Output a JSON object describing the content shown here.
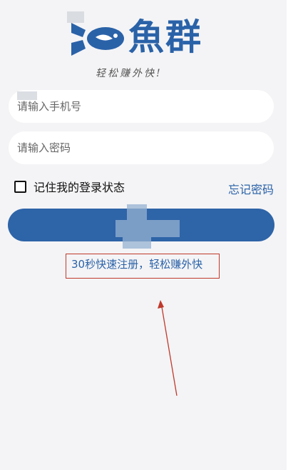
{
  "app": {
    "name": "魚群",
    "slogan": "轻松赚外快!"
  },
  "login": {
    "phone_placeholder": "请输入手机号",
    "password_placeholder": "请输入密码",
    "remember_label": "记住我的登录状态",
    "remember_checked": false,
    "forgot_label": "忘记密码",
    "register_label": "30秒快速注册，轻松赚外快"
  },
  "colors": {
    "brand": "#2a62a8",
    "button": "#2e64a8",
    "annotation": "#c0392b",
    "background": "#f4f4f6"
  },
  "icons": {
    "logo": "fish-logo-icon",
    "annotation": "arrow-annotation-icon"
  }
}
